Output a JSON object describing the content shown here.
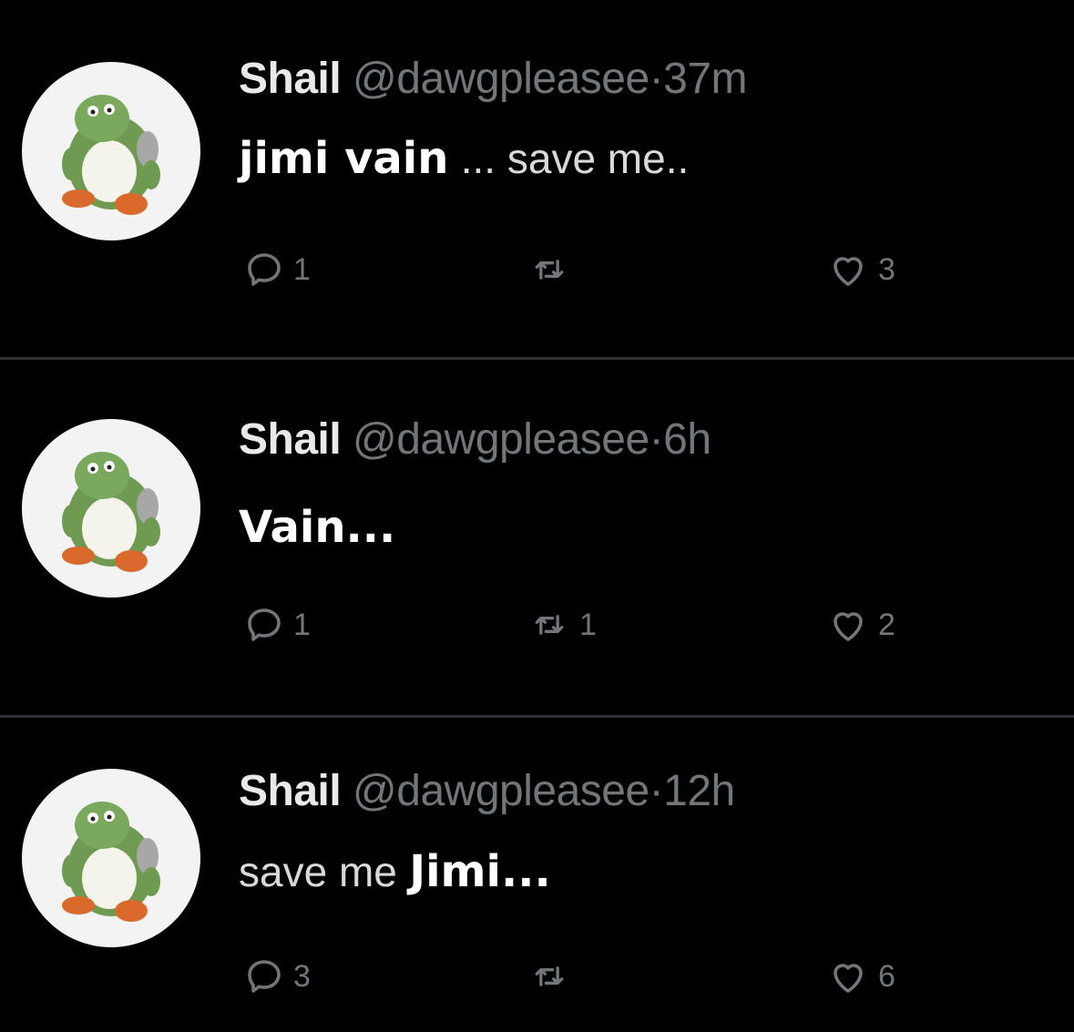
{
  "tweets": [
    {
      "author": "Shail",
      "handle": "@dawgpleasee",
      "separator": "·",
      "time": "37m",
      "text_overlay": "jimi vain",
      "text_plain": "... save me..",
      "reply_count": "1",
      "retweet_count": "",
      "like_count": "3"
    },
    {
      "author": "Shail",
      "handle": "@dawgpleasee",
      "separator": "·",
      "time": "6h",
      "text_overlay": "Vain...",
      "text_plain": "",
      "reply_count": "1",
      "retweet_count": "1",
      "like_count": "2"
    },
    {
      "author": "Shail",
      "handle": "@dawgpleasee",
      "separator": "·",
      "time": "12h",
      "text_plain": "save me",
      "text_overlay": "Jimi...",
      "reply_count": "3",
      "retweet_count": "",
      "like_count": "6"
    }
  ],
  "icons": {
    "reply": "reply-icon",
    "retweet": "retweet-icon",
    "like": "heart-icon",
    "avatar": "yoshi-avatar"
  },
  "colors": {
    "background": "#000000",
    "muted": "#71767b",
    "text": "#e7e9ea",
    "divider": "#2f3336"
  }
}
